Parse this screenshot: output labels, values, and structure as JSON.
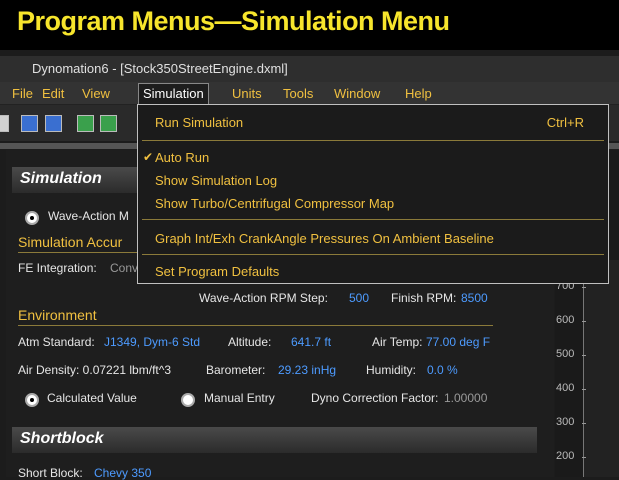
{
  "banner": {
    "title": "Program Menus—Simulation Menu"
  },
  "window": {
    "title": "Dynomation6 - [Stock350StreetEngine.dxml]"
  },
  "menubar": {
    "items": [
      "File",
      "Edit",
      "View",
      "Simulation",
      "Units",
      "Tools",
      "Window",
      "Help"
    ]
  },
  "dropdown": {
    "run_simulation": "Run Simulation",
    "run_shortcut": "Ctrl+R",
    "check_mark": "✔",
    "auto_run": "Auto Run",
    "show_log": "Show Simulation Log",
    "show_turbo": "Show Turbo/Centrifugal Compressor Map",
    "graph_pressures": "Graph Int/Exh CrankAngle Pressures On Ambient Baseline",
    "set_defaults": "Set Program Defaults"
  },
  "simulation": {
    "header": "Simulation",
    "wave_action": "Wave-Action M",
    "accuracy_hdr": "Simulation Accur",
    "fe_integration_label": "FE Integration:",
    "fe_integration_value": "Conv",
    "rpm_step_label": "Wave-Action RPM Step:",
    "rpm_step_value": "500",
    "finish_rpm_label": "Finish RPM:",
    "finish_rpm_value": "8500"
  },
  "environment": {
    "header": "Environment",
    "atm_label": "Atm Standard:",
    "atm_value": "J1349, Dym-6 Std",
    "altitude_label": "Altitude:",
    "altitude_value": "641.7 ft",
    "air_temp_label": "Air Temp:",
    "air_temp_value": "77.00 deg F",
    "air_density": "Air Density: 0.07221 lbm/ft^3",
    "barometer_label": "Barometer:",
    "barometer_value": "29.23 inHg",
    "humidity_label": "Humidity:",
    "humidity_value": "0.0 %",
    "calculated": "Calculated Value",
    "manual": "Manual Entry",
    "dyno_corr_label": "Dyno Correction Factor:",
    "dyno_corr_value": "1.00000"
  },
  "shortblock": {
    "header": "Shortblock",
    "label": "Short Block:",
    "value": "Chevy 350"
  },
  "graph": {
    "ticks": [
      "700",
      "600",
      "500",
      "400",
      "300",
      "200"
    ]
  },
  "colors": {
    "accent": "#f0c040",
    "value_blue": "#4d9bff",
    "banner_yellow": "#f7e52c"
  }
}
